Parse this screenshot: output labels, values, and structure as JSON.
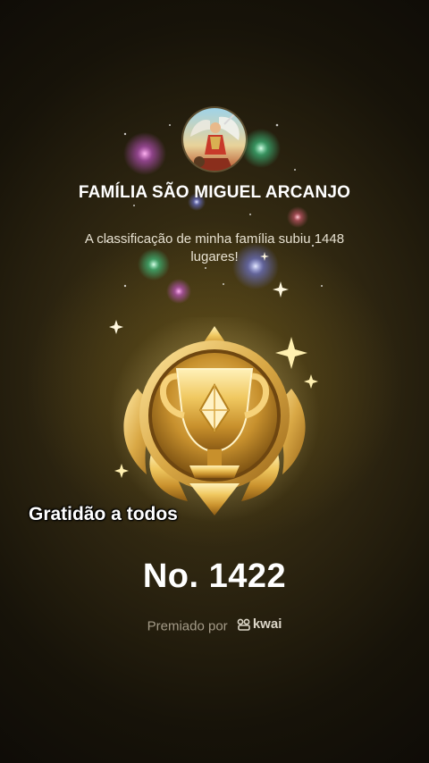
{
  "family": {
    "name": "FAMÍLIA SÃO MIGUEL ARCANJO",
    "message": "A classificação de minha família subiu 1448 lugares!"
  },
  "overlay": {
    "caption": "Gratidão a todos"
  },
  "rank": {
    "label": "No. 1422"
  },
  "footer": {
    "awarded_by": "Premiado por",
    "brand": "kwai"
  },
  "colors": {
    "background": "#2c2410",
    "gold": "#e0b84e",
    "text_primary": "#ffffff",
    "text_muted": "#a49b88"
  },
  "icons": [
    "avatar-image",
    "trophy-badge-icon",
    "sparkle-icon",
    "kwai-logo-icon"
  ]
}
